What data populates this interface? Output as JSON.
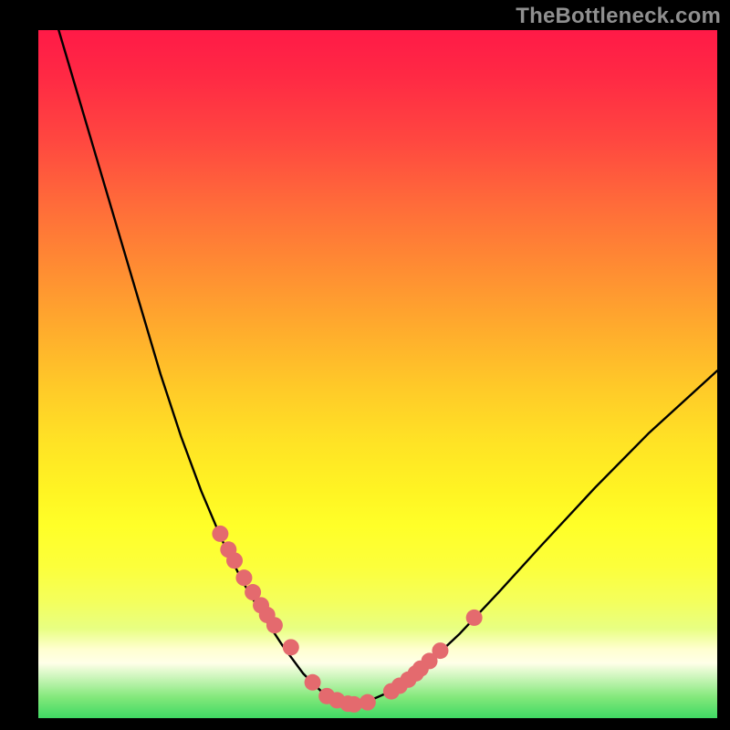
{
  "watermark": "TheBottleneck.com",
  "chart_data": {
    "type": "line",
    "title": "",
    "xlabel": "",
    "ylabel": "",
    "xlim": [
      0,
      100
    ],
    "ylim": [
      0,
      100
    ],
    "grid": false,
    "legend": false,
    "series": [
      {
        "name": "curve",
        "color": "#000000",
        "x": [
          3,
          6,
          9,
          12,
          15,
          18,
          21,
          24,
          27,
          30,
          33,
          36,
          39,
          40.5,
          42,
          43.5,
          45,
          46.5,
          48,
          51,
          54,
          58,
          62,
          68,
          74,
          82,
          90,
          97,
          100
        ],
        "y": [
          100,
          90,
          80,
          70,
          60,
          50,
          41,
          33,
          26,
          20,
          15,
          10.5,
          6.5,
          5,
          3.6,
          2.6,
          2,
          2,
          2.2,
          3.5,
          5.4,
          8.5,
          12.2,
          18.5,
          25,
          33.5,
          41.5,
          47.8,
          50.5
        ]
      }
    ],
    "points": {
      "name": "markers",
      "color": "#e46a6e",
      "radius": 9,
      "x": [
        26.8,
        28.0,
        28.9,
        30.3,
        31.6,
        32.8,
        33.7,
        34.8,
        37.2,
        40.4,
        42.5,
        44.0,
        45.6,
        46.5,
        48.5,
        52.0,
        53.2,
        54.5,
        55.6,
        56.3,
        57.6,
        59.2,
        64.2
      ],
      "y": [
        26.8,
        24.5,
        22.9,
        20.4,
        18.3,
        16.4,
        15.0,
        13.5,
        10.3,
        5.2,
        3.2,
        2.6,
        2.1,
        2.0,
        2.3,
        3.9,
        4.7,
        5.6,
        6.5,
        7.2,
        8.3,
        9.8,
        14.6
      ]
    },
    "background_gradient": {
      "top": "#ff1a47",
      "mid": "#fff423",
      "bottom": "#3fd964"
    }
  }
}
